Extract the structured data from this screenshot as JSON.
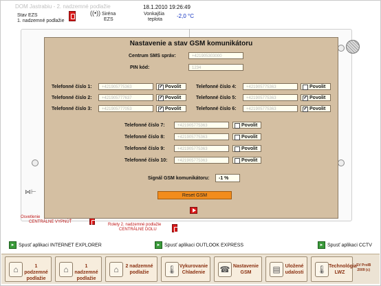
{
  "header": {
    "app_title": "DOM Jastrabiu - 2. nadzemné podlažie",
    "ezs_label": "Stav EZS",
    "ezs_floor": "1. nadzemné podlažie",
    "siren_label": "Siréna",
    "siren_sub": "EZS",
    "datetime": "18.1.2010 19:26:49",
    "temp_label": "Vonkajšia",
    "temp_sub": "teplota",
    "temp_value": "-2,0 °C",
    "antenna_icon": "antenna-icon"
  },
  "floorplan": {
    "lighting_label": "Osvetlenie",
    "lighting_sub": "CENTRÁLNE VYPNÚŤ",
    "blinds_label": "Rolety 2. nadzemné podlažie",
    "blinds_sub": "CENTRÁLNE DOLU"
  },
  "modal": {
    "title": "Nastavenie a stav GSM komunikátoru",
    "sms_center_label": "Centrum SMS správ:",
    "sms_center_value": "+421905303000",
    "pin_label": "PIN kód:",
    "pin_value": "1234",
    "phones_left": [
      {
        "label": "Telefonné číslo 1:",
        "value": "+421905775363",
        "checked": true,
        "allow": "Povolit"
      },
      {
        "label": "Telefonné číslo 2:",
        "value": "+421905777637",
        "checked": true,
        "allow": "Povolit"
      },
      {
        "label": "Telefonné číslo 3:",
        "value": "+421905777053",
        "checked": true,
        "allow": "Povolit"
      }
    ],
    "phones_right": [
      {
        "label": "Telefonné číslo 4:",
        "value": "+421905775363",
        "checked": false,
        "allow": "Povolit"
      },
      {
        "label": "Telefonné číslo 5:",
        "value": "+421905775363",
        "checked": true,
        "allow": "Povolit"
      },
      {
        "label": "Telefonné číslo 6:",
        "value": "+421905775363",
        "checked": true,
        "allow": "Povolit"
      }
    ],
    "phones_center": [
      {
        "label": "Telefonné číslo  7:",
        "value": "+421905775363",
        "checked": false,
        "allow": "Povolit"
      },
      {
        "label": "Telefonné číslo  8:",
        "value": "+421905775363",
        "checked": false,
        "allow": "Povolit"
      },
      {
        "label": "Telefonné číslo  9:",
        "value": "+421905775363",
        "checked": false,
        "allow": "Povolit"
      },
      {
        "label": "Telefonné číslo 10:",
        "value": "+421905775363",
        "checked": false,
        "allow": "Povolit"
      }
    ],
    "signal_label": "Signál GSM komunikátoru:",
    "signal_value": "-1 %",
    "reset_label": "Reset GSM"
  },
  "launchers": [
    {
      "label": "Spusť aplikaci INTERNET EXPLORER"
    },
    {
      "label": "Spusť aplikaci OUTLOOK EXPRESS"
    },
    {
      "label": "Spusť aplikaci CCTV"
    }
  ],
  "nav": [
    {
      "label": "1 podzemné\npodlažie",
      "icon": "home-icon"
    },
    {
      "label": "1 nadzemné\npodlažie",
      "icon": "home-icon"
    },
    {
      "label": "2 nadzemné\npodlažie",
      "icon": "home-icon"
    },
    {
      "label": "Vykurovanie\nChladenie",
      "icon": "thermometer-icon"
    },
    {
      "label": "Nastavenie\nGSM",
      "icon": "phone-icon"
    },
    {
      "label": "Uložené\nudalosti",
      "icon": "log-icon"
    },
    {
      "label": "Technológia\nLWZ",
      "icon": "thermometer-icon"
    }
  ],
  "footer_brand": "SV ProIB\n2009 (c)"
}
